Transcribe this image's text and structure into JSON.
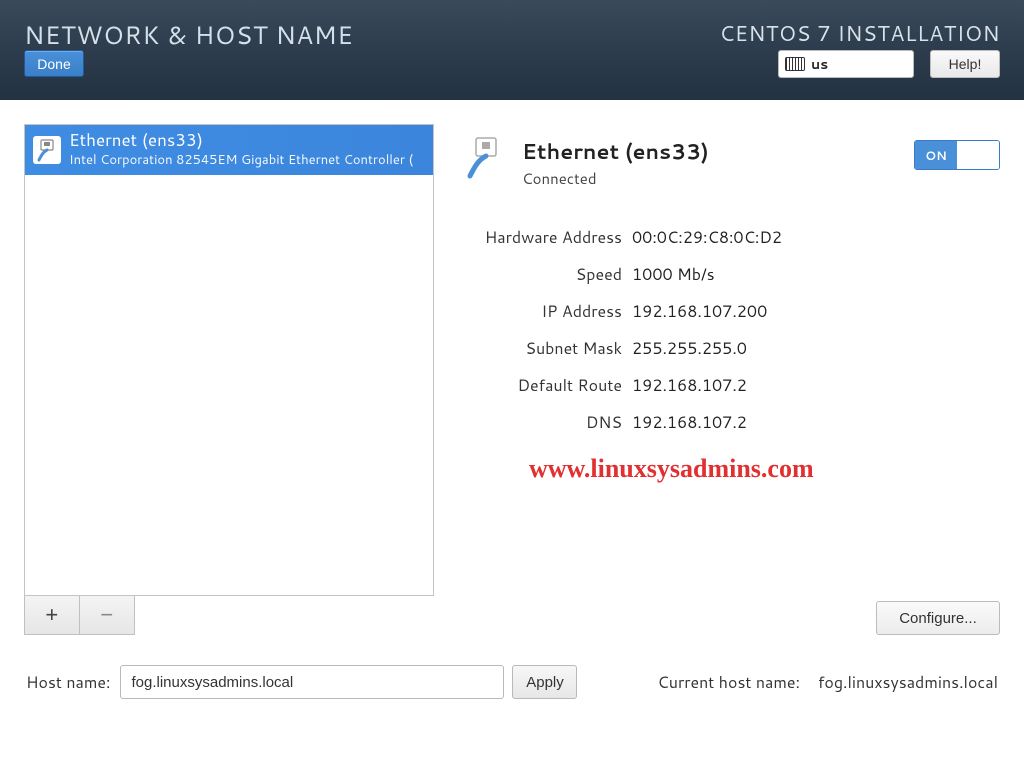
{
  "header": {
    "title": "NETWORK & HOST NAME",
    "install_title": "CENTOS 7 INSTALLATION",
    "done_label": "Done",
    "help_label": "Help!",
    "keyboard_layout": "us"
  },
  "devices": [
    {
      "title": "Ethernet (ens33)",
      "subtitle": "Intel Corporation 82545EM Gigabit Ethernet Controller (",
      "selected": true
    }
  ],
  "connection": {
    "title": "Ethernet (ens33)",
    "status": "Connected",
    "toggle_on_label": "ON",
    "details": [
      {
        "label": "Hardware Address",
        "value": "00:0C:29:C8:0C:D2"
      },
      {
        "label": "Speed",
        "value": "1000 Mb/s"
      },
      {
        "label": "IP Address",
        "value": "192.168.107.200"
      },
      {
        "label": "Subnet Mask",
        "value": "255.255.255.0"
      },
      {
        "label": "Default Route",
        "value": "192.168.107.2"
      },
      {
        "label": "DNS",
        "value": "192.168.107.2"
      }
    ],
    "configure_label": "Configure..."
  },
  "watermark": "www.linuxsysadmins.com",
  "hostname": {
    "label": "Host name:",
    "value": "fog.linuxsysadmins.local",
    "apply_label": "Apply",
    "current_label": "Current host name:",
    "current_value": "fog.linuxsysadmins.local"
  },
  "buttons": {
    "add": "+",
    "remove": "−"
  }
}
